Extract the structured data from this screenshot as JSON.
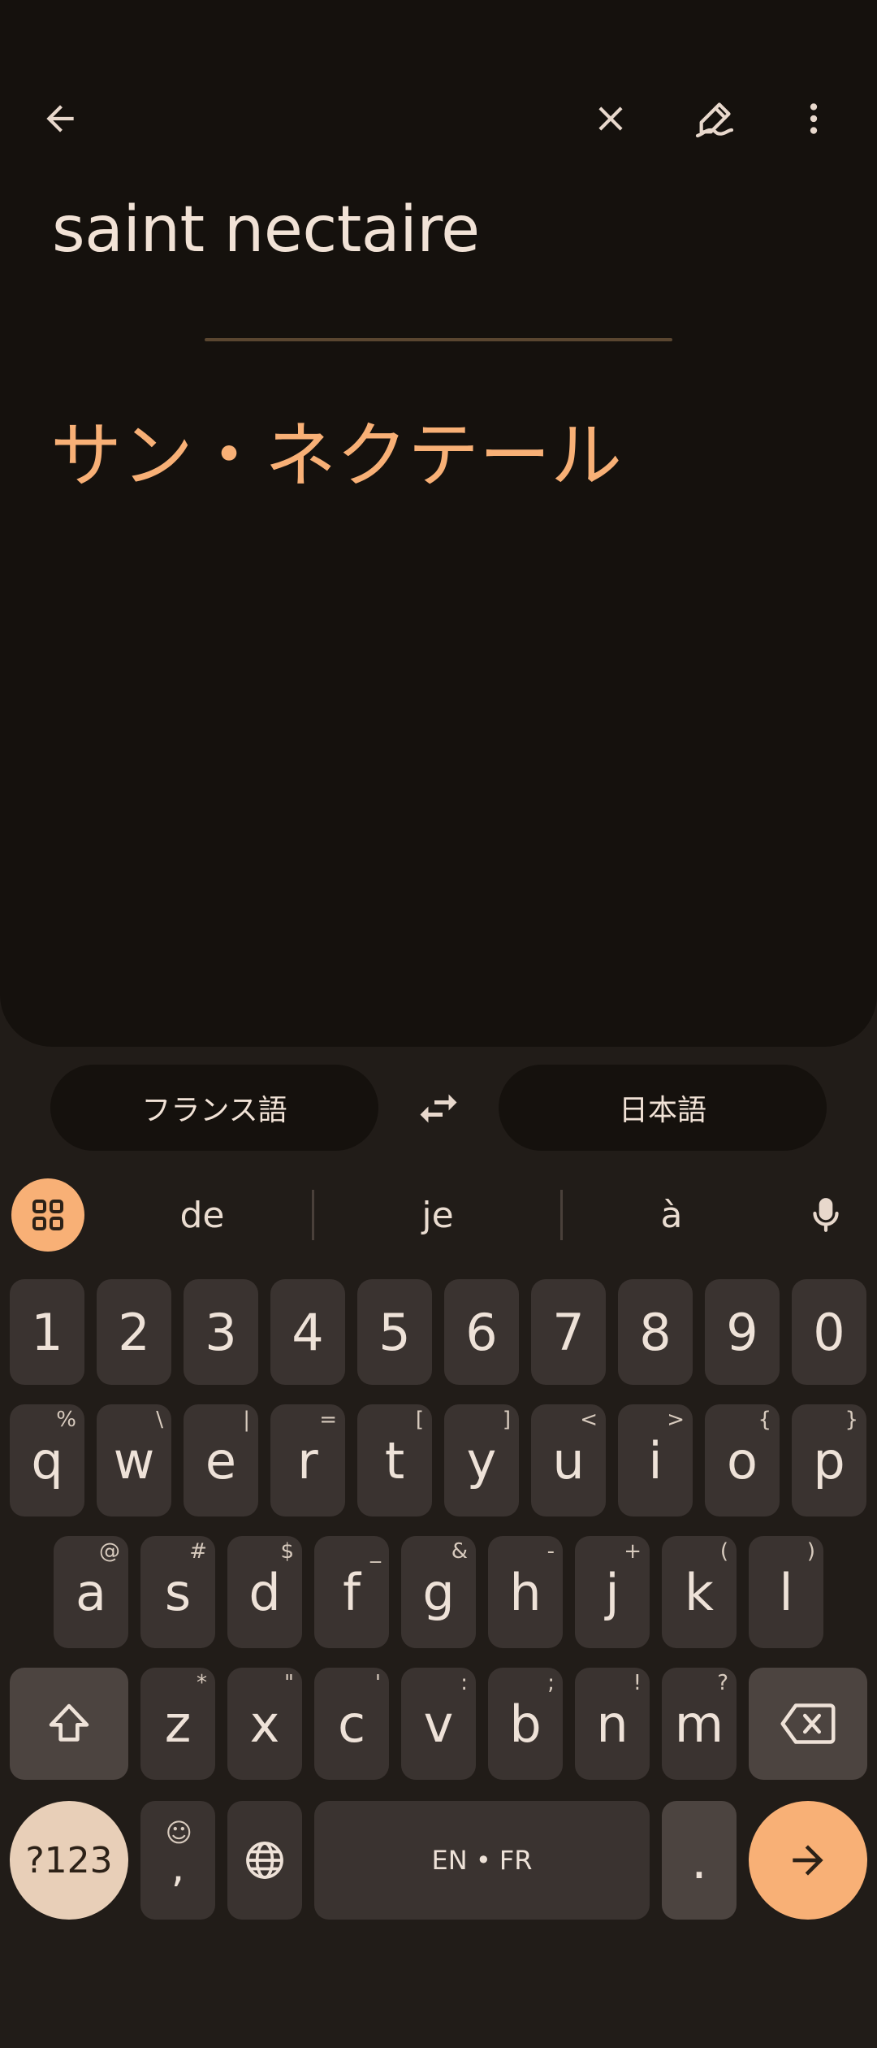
{
  "header": {
    "back_icon": "arrow-back-icon",
    "clear_icon": "close-icon",
    "handwriting_icon": "handwriting-pen-icon",
    "more_icon": "more-vert-icon"
  },
  "source": {
    "text": "saint nectaire"
  },
  "translation": {
    "text": "サン・ネクテール"
  },
  "languages": {
    "source_lang": "フランス語",
    "target_lang": "日本語",
    "swap_icon": "swap-arrows-icon"
  },
  "suggestions": {
    "items": [
      "de",
      "je",
      "à"
    ],
    "toolbar_icon": "grid-apps-icon",
    "mic_icon": "mic-icon"
  },
  "keyboard": {
    "number_row": [
      "1",
      "2",
      "3",
      "4",
      "5",
      "6",
      "7",
      "8",
      "9",
      "0"
    ],
    "row1": [
      {
        "k": "q",
        "h": "%"
      },
      {
        "k": "w",
        "h": "\\"
      },
      {
        "k": "e",
        "h": "|"
      },
      {
        "k": "r",
        "h": "="
      },
      {
        "k": "t",
        "h": "["
      },
      {
        "k": "y",
        "h": "]"
      },
      {
        "k": "u",
        "h": "<"
      },
      {
        "k": "i",
        "h": ">"
      },
      {
        "k": "o",
        "h": "{"
      },
      {
        "k": "p",
        "h": "}"
      }
    ],
    "row2": [
      {
        "k": "a",
        "h": "@"
      },
      {
        "k": "s",
        "h": "#"
      },
      {
        "k": "d",
        "h": "$"
      },
      {
        "k": "f",
        "h": "_"
      },
      {
        "k": "g",
        "h": "&"
      },
      {
        "k": "h",
        "h": "-"
      },
      {
        "k": "j",
        "h": "+"
      },
      {
        "k": "k",
        "h": "("
      },
      {
        "k": "l",
        "h": ")"
      }
    ],
    "row3": [
      {
        "k": "z",
        "h": "*"
      },
      {
        "k": "x",
        "h": "\""
      },
      {
        "k": "c",
        "h": "'"
      },
      {
        "k": "v",
        "h": ":"
      },
      {
        "k": "b",
        "h": ";"
      },
      {
        "k": "n",
        "h": "!"
      },
      {
        "k": "m",
        "h": "?"
      }
    ],
    "symbols_label": "?123",
    "comma_label": ",",
    "emoji_hint": "☺",
    "space_label": "EN • FR",
    "period_label": ".",
    "shift_icon": "shift-icon",
    "backspace_icon": "backspace-icon",
    "globe_icon": "globe-icon",
    "enter_icon": "arrow-forward-icon"
  }
}
